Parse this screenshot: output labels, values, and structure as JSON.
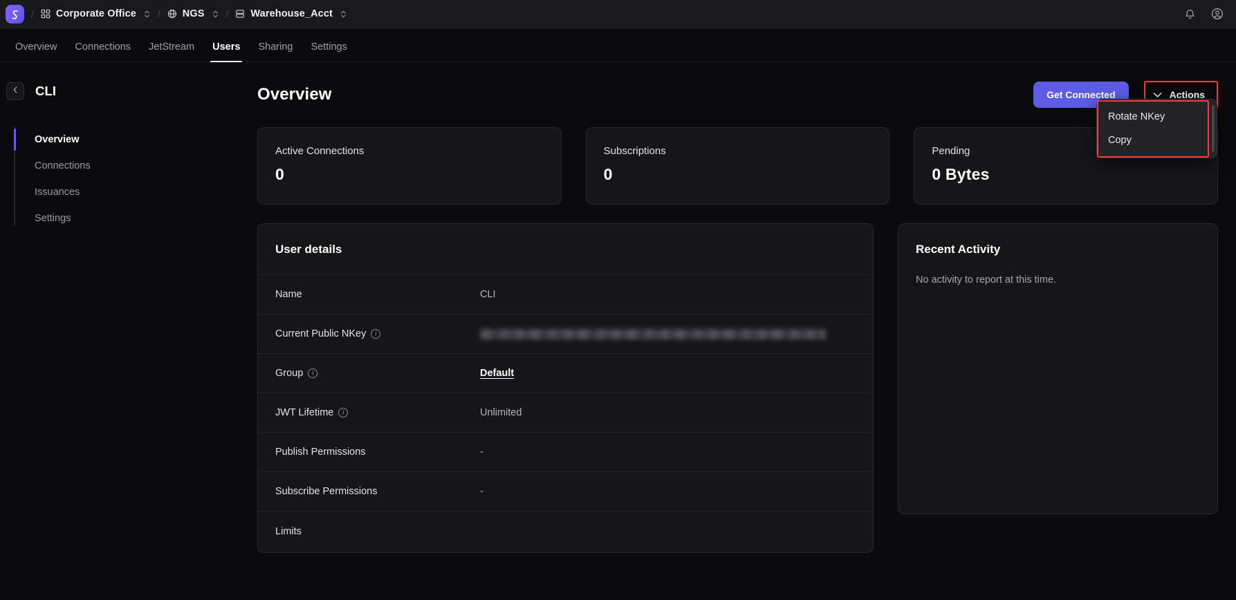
{
  "topbar": {
    "logo_icon": "synadia-swirl-logo",
    "breadcrumbs": [
      {
        "icon": "grid-icon",
        "label": "Corporate Office",
        "chevron": "chevron-up-down-icon"
      },
      {
        "icon": "globe-icon",
        "label": "NGS",
        "chevron": "chevron-up-down-icon"
      },
      {
        "icon": "server-stack-icon",
        "label": "Warehouse_Acct",
        "chevron": "chevron-up-down-icon"
      }
    ],
    "separator": "/",
    "right_icons": [
      {
        "name": "notifications-bell-icon"
      },
      {
        "name": "user-account-icon"
      }
    ]
  },
  "nav_tabs": [
    {
      "label": "Overview",
      "active": false
    },
    {
      "label": "Connections",
      "active": false
    },
    {
      "label": "JetStream",
      "active": false
    },
    {
      "label": "Users",
      "active": true
    },
    {
      "label": "Sharing",
      "active": false
    },
    {
      "label": "Settings",
      "active": false
    }
  ],
  "sidebar": {
    "back_icon": "chevron-left-icon",
    "title": "CLI",
    "items": [
      {
        "label": "Overview",
        "active": true
      },
      {
        "label": "Connections",
        "active": false
      },
      {
        "label": "Issuances",
        "active": false
      },
      {
        "label": "Settings",
        "active": false
      }
    ]
  },
  "main": {
    "page_title": "Overview",
    "get_connected_label": "Get Connected",
    "actions_label": "Actions",
    "actions_chevron_icon": "chevron-down-icon",
    "stats": [
      {
        "label": "Active Connections",
        "value": "0"
      },
      {
        "label": "Subscriptions",
        "value": "0"
      },
      {
        "label": "Pending",
        "value": "0 Bytes"
      }
    ],
    "details": {
      "heading": "User details",
      "rows": [
        {
          "label": "Name",
          "value": "CLI",
          "info": false,
          "type": "text"
        },
        {
          "label": "Current Public NKey",
          "value": "",
          "info": true,
          "type": "redacted"
        },
        {
          "label": "Group",
          "value": "Default",
          "info": true,
          "type": "link"
        },
        {
          "label": "JWT Lifetime",
          "value": "Unlimited",
          "info": true,
          "type": "text"
        },
        {
          "label": "Publish Permissions",
          "value": "-",
          "info": false,
          "type": "text"
        },
        {
          "label": "Subscribe Permissions",
          "value": "-",
          "info": false,
          "type": "text"
        },
        {
          "label": "Limits",
          "value": "",
          "info": false,
          "type": "text"
        }
      ]
    },
    "activity": {
      "title": "Recent Activity",
      "empty_text": "No activity to report at this time."
    },
    "actions_menu": {
      "items": [
        {
          "label": "Rotate NKey"
        },
        {
          "label": "Copy"
        }
      ]
    }
  },
  "colors": {
    "accent_primary": "#5e5ce6",
    "sidebar_active_bar": "#6c5ce7",
    "annotation_red": "#fb3b3b",
    "page_background": "#0b0b0d",
    "card_background": "#161619",
    "topbar_background": "#19191c"
  }
}
